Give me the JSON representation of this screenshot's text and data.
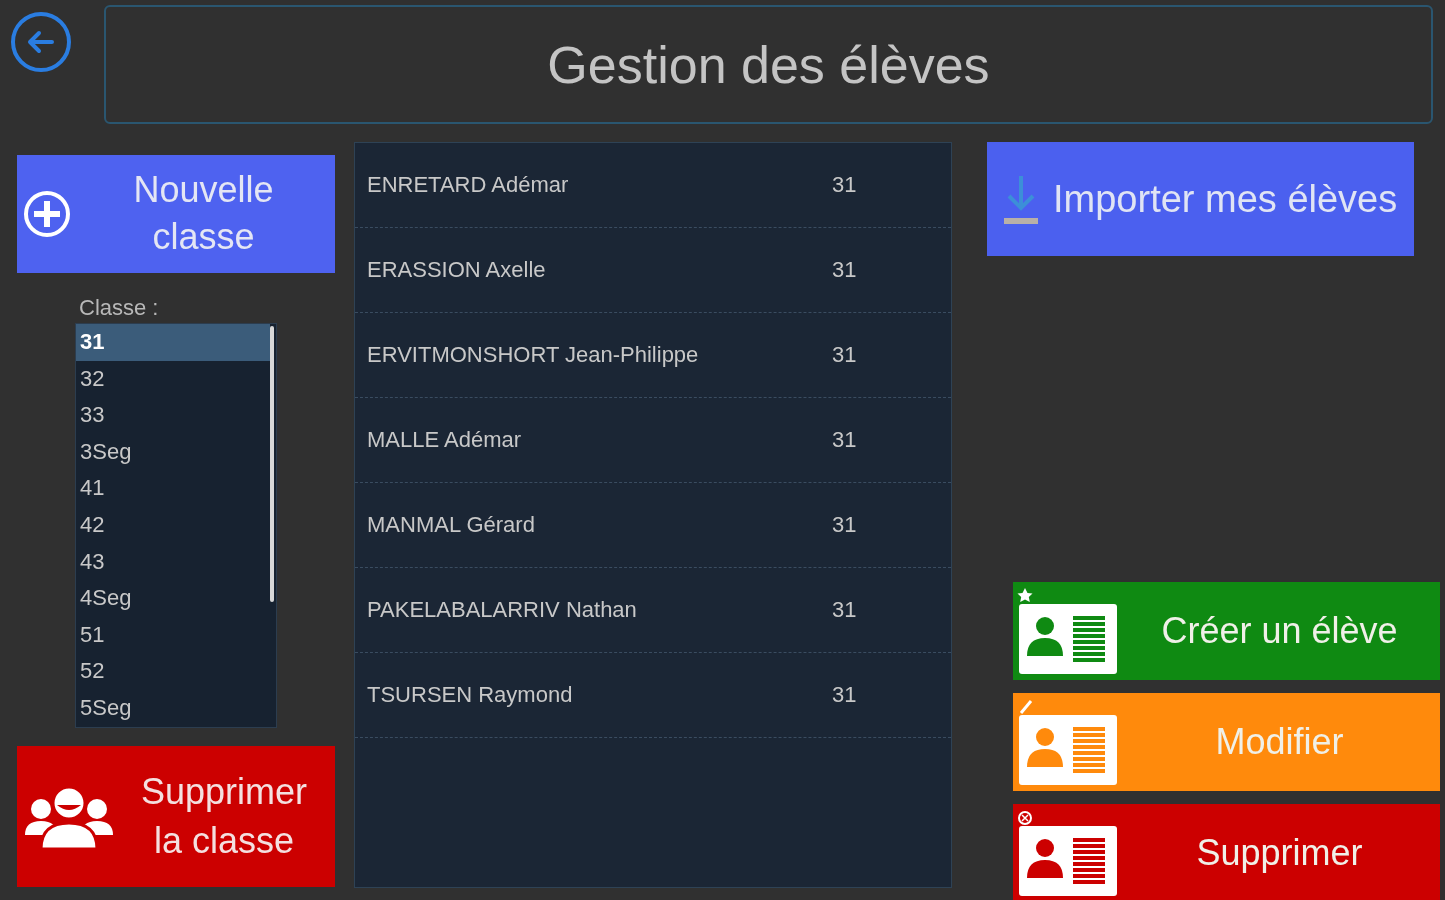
{
  "header": {
    "title": "Gestion des élèves"
  },
  "new_class_button": {
    "label": "Nouvelle classe"
  },
  "class_list": {
    "label": "Classe :",
    "items": [
      {
        "label": "31",
        "selected": true
      },
      {
        "label": "32",
        "selected": false
      },
      {
        "label": "33",
        "selected": false
      },
      {
        "label": "3Seg",
        "selected": false
      },
      {
        "label": "41",
        "selected": false
      },
      {
        "label": "42",
        "selected": false
      },
      {
        "label": "43",
        "selected": false
      },
      {
        "label": "4Seg",
        "selected": false
      },
      {
        "label": "51",
        "selected": false
      },
      {
        "label": "52",
        "selected": false
      },
      {
        "label": "5Seg",
        "selected": false
      }
    ]
  },
  "delete_class_button": {
    "label": "Supprimer la classe"
  },
  "students": [
    {
      "name": "ENRETARD Adémar",
      "class": "31"
    },
    {
      "name": "ERASSION Axelle",
      "class": "31"
    },
    {
      "name": "ERVITMONSHORT Jean-Philippe",
      "class": "31"
    },
    {
      "name": "MALLE Adémar",
      "class": "31"
    },
    {
      "name": "MANMAL Gérard",
      "class": "31"
    },
    {
      "name": "PAKELABALARRIV Nathan",
      "class": "31"
    },
    {
      "name": "TSURSEN Raymond",
      "class": "31"
    }
  ],
  "import_button": {
    "label": "Importer mes élèves"
  },
  "actions": [
    {
      "kind": "create",
      "label": "Créer un élève"
    },
    {
      "kind": "edit",
      "label": "Modifier"
    },
    {
      "kind": "delete",
      "label": "Supprimer"
    }
  ]
}
